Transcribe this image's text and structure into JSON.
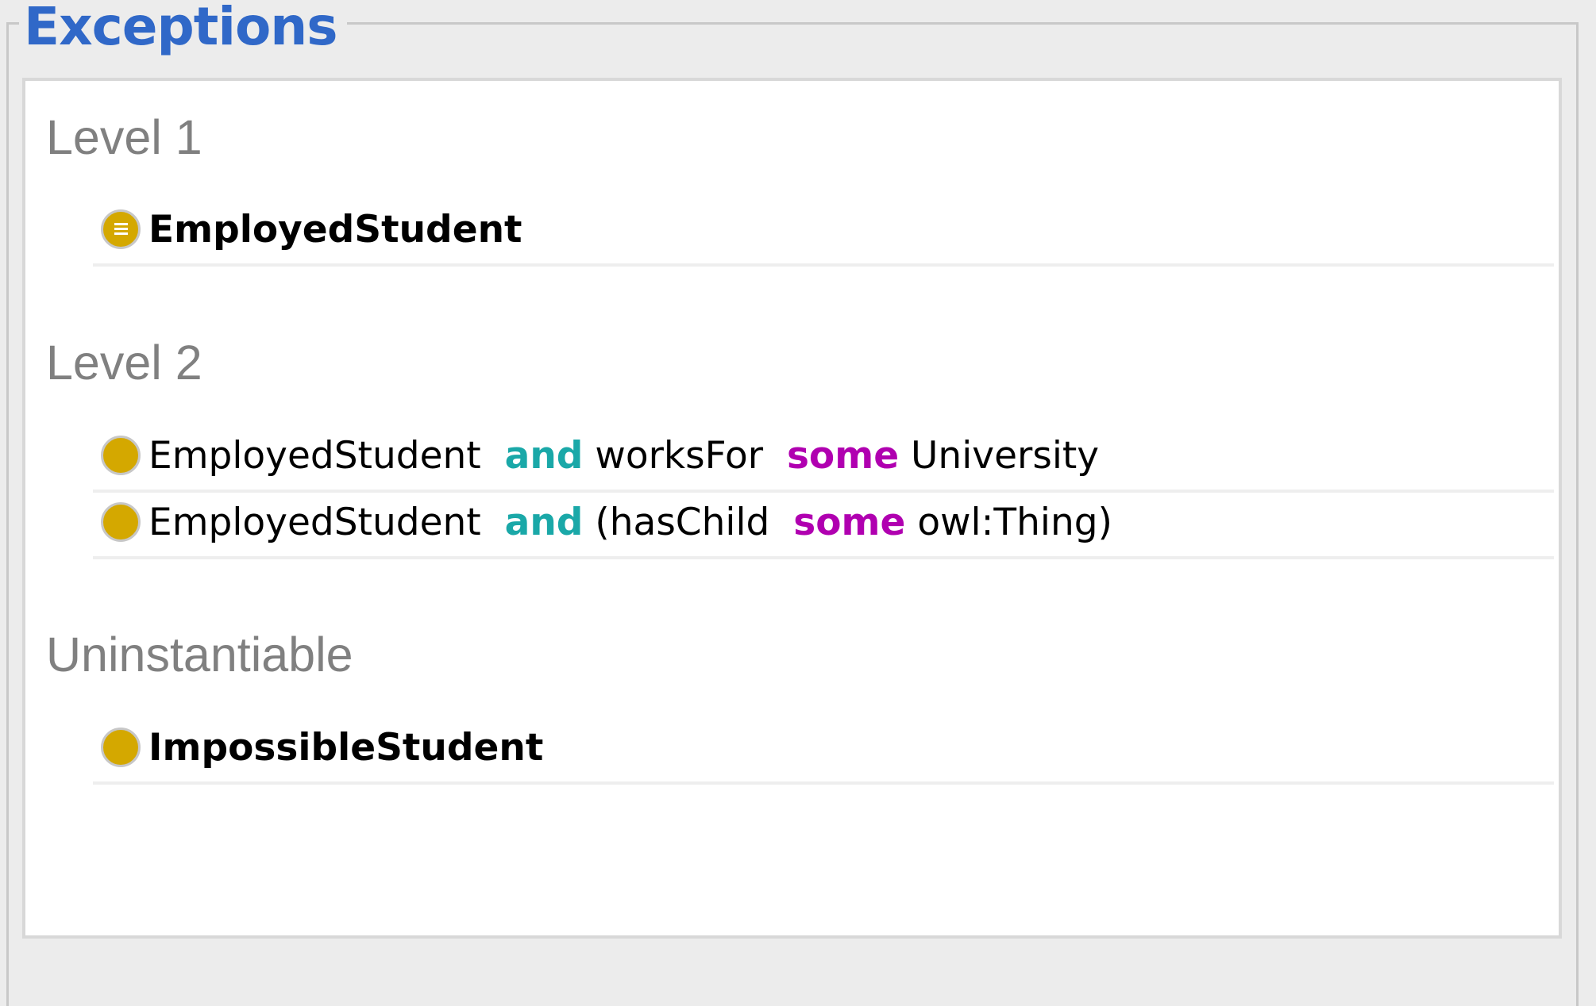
{
  "title": "Exceptions",
  "colors": {
    "title": "#3068c8",
    "bullet": "#d4a800",
    "keyword_and": "#1aa8a8",
    "keyword_some": "#b000b0",
    "header_text": "#808080"
  },
  "sections": [
    {
      "header": "Level 1",
      "rows": [
        {
          "icon": "equivalent-class-icon",
          "text": "EmployedStudent"
        }
      ]
    },
    {
      "header": "Level 2",
      "rows": [
        {
          "icon": "class-expression-icon",
          "parts": [
            "EmployedStudent",
            "and",
            "worksFor",
            "some",
            "University"
          ]
        },
        {
          "icon": "class-expression-icon",
          "parts": [
            "EmployedStudent",
            "and",
            "(hasChild",
            "some",
            "owl:Thing)"
          ]
        }
      ]
    },
    {
      "header": "Uninstantiable",
      "rows": [
        {
          "icon": "class-icon",
          "text": "ImpossibleStudent"
        }
      ]
    }
  ]
}
